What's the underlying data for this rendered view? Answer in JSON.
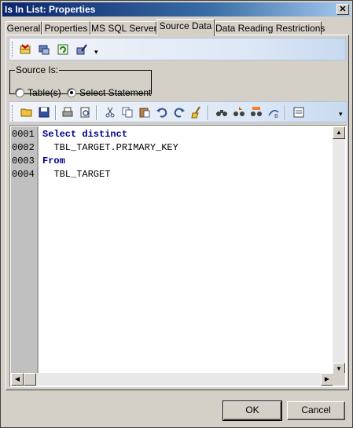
{
  "window": {
    "title": "Is In List: Properties",
    "close_glyph": "✕"
  },
  "tabs": [
    {
      "label": "General",
      "active": false
    },
    {
      "label": "Properties",
      "active": false
    },
    {
      "label": "MS SQL Server",
      "active": false
    },
    {
      "label": "Source Data",
      "active": true
    },
    {
      "label": "Data Reading Restrictions",
      "active": false
    }
  ],
  "source": {
    "legend": "Source Is:",
    "options": [
      {
        "label": "Table(s)",
        "checked": false
      },
      {
        "label": "Select Statement",
        "checked": true
      }
    ]
  },
  "editor": {
    "lines": [
      {
        "no": "0001",
        "text": "Select distinct",
        "keyword": true
      },
      {
        "no": "0002",
        "text": "  TBL_TARGET.PRIMARY_KEY",
        "keyword": false
      },
      {
        "no": "0003",
        "text": "From",
        "keyword": true
      },
      {
        "no": "0004",
        "text": "  TBL_TARGET",
        "keyword": false
      }
    ]
  },
  "buttons": {
    "ok": "OK",
    "cancel": "Cancel"
  },
  "toolbar_icons": {
    "top": [
      "table-wizard-icon",
      "database-icon",
      "refresh-icon",
      "query-builder-icon"
    ],
    "editor": [
      "open-icon",
      "save-icon",
      "print-icon",
      "print-preview-icon",
      "cut-icon",
      "copy-icon",
      "paste-icon",
      "undo-icon",
      "redo-icon",
      "clear-icon",
      "find-icon",
      "find-next-icon",
      "replace-icon",
      "goto-icon",
      "sql-options-icon"
    ]
  },
  "colors": {
    "keyword": "#00008b",
    "title_bar": "#0a246a",
    "dialog": "#d4d0c8"
  }
}
